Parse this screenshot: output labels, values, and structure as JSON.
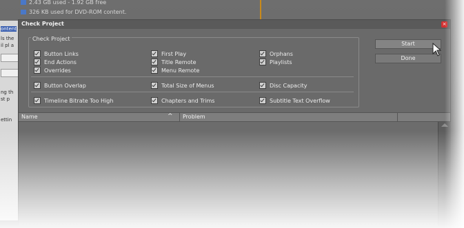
{
  "background": {
    "top_lines": [
      "2.43 GB used - 1.92 GB free",
      "326 KB used for DVD-ROM content."
    ],
    "left_texts": [
      "ontent",
      "ls the",
      "il pl a",
      "ng th",
      "st p",
      "ettin"
    ]
  },
  "dialog": {
    "title": "Check Project",
    "close_symbol": "×",
    "group_label": "Check Project",
    "checkboxes": [
      {
        "label": "Button Links",
        "checked": true
      },
      {
        "label": "End Actions",
        "checked": true
      },
      {
        "label": "Overrides",
        "checked": true
      },
      {
        "label": "First Play",
        "checked": true
      },
      {
        "label": "Title Remote",
        "checked": true
      },
      {
        "label": "Menu Remote",
        "checked": true
      },
      {
        "label": "Orphans",
        "checked": true
      },
      {
        "label": "Playlists",
        "checked": true
      },
      {
        "label": "Button Overlap",
        "checked": true
      },
      {
        "label": "Total Size of Menus",
        "checked": true
      },
      {
        "label": "Disc Capacity",
        "checked": true
      },
      {
        "label": "Timeline Bitrate Too High",
        "checked": true
      },
      {
        "label": "Chapters and Trims",
        "checked": true
      },
      {
        "label": "Subtitle Text Overflow",
        "checked": true
      }
    ],
    "buttons": {
      "start": "Start",
      "done": "Done"
    },
    "list": {
      "col_name": "Name",
      "sort_icon": "^",
      "col_problem": "Problem"
    }
  },
  "colors": {
    "dialog_bg": "#6a6a6a",
    "close_red": "#d33030",
    "accent_line": "#c98a1a"
  }
}
